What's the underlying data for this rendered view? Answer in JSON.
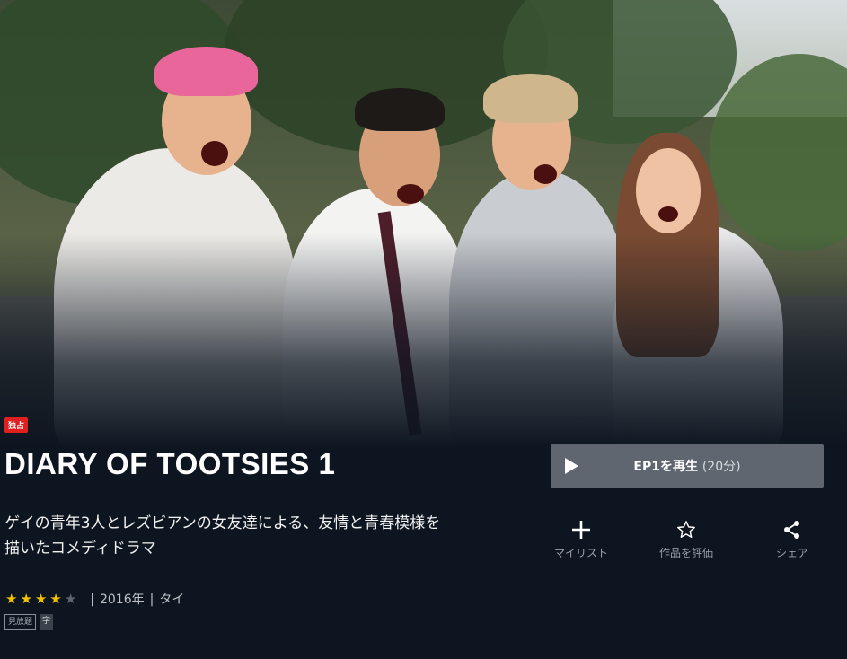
{
  "badge": "独占",
  "title": "DIARY OF TOOTSIES 1",
  "description": "ゲイの青年3人とレズビアンの女友達による、友情と青春模様を描いたコメディドラマ",
  "rating": {
    "value": 4,
    "max": 5
  },
  "meta": {
    "year": "2016年",
    "country": "タイ",
    "separator": "|"
  },
  "chips": [
    "見放題",
    "字"
  ],
  "play_button": {
    "label": "EP1を再生",
    "duration": "(20分)"
  },
  "actions": [
    {
      "icon": "plus-icon",
      "label": "マイリスト"
    },
    {
      "icon": "star-outline-icon",
      "label": "作品を評価"
    },
    {
      "icon": "share-icon",
      "label": "シェア"
    }
  ],
  "colors": {
    "background": "#0d1520",
    "badge": "#e02020",
    "star": "#f2c200",
    "play_button": "#5f6670"
  }
}
